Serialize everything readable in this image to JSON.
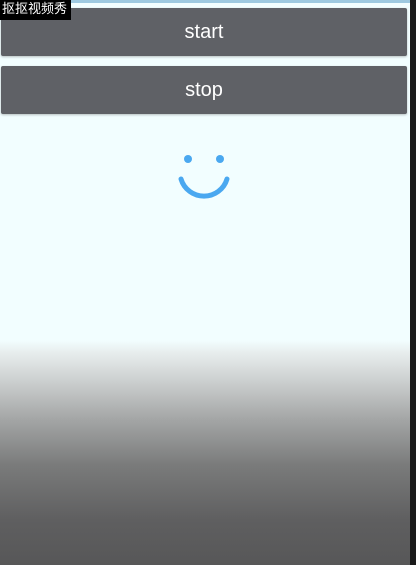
{
  "watermark": "抠抠视频秀",
  "buttons": {
    "start_label": "start",
    "stop_label": "stop"
  },
  "colors": {
    "background": "#f2feff",
    "button": "#5f6166",
    "smiley": "#4aa8f0"
  },
  "graphic": {
    "icon": "smiley-face-icon"
  }
}
